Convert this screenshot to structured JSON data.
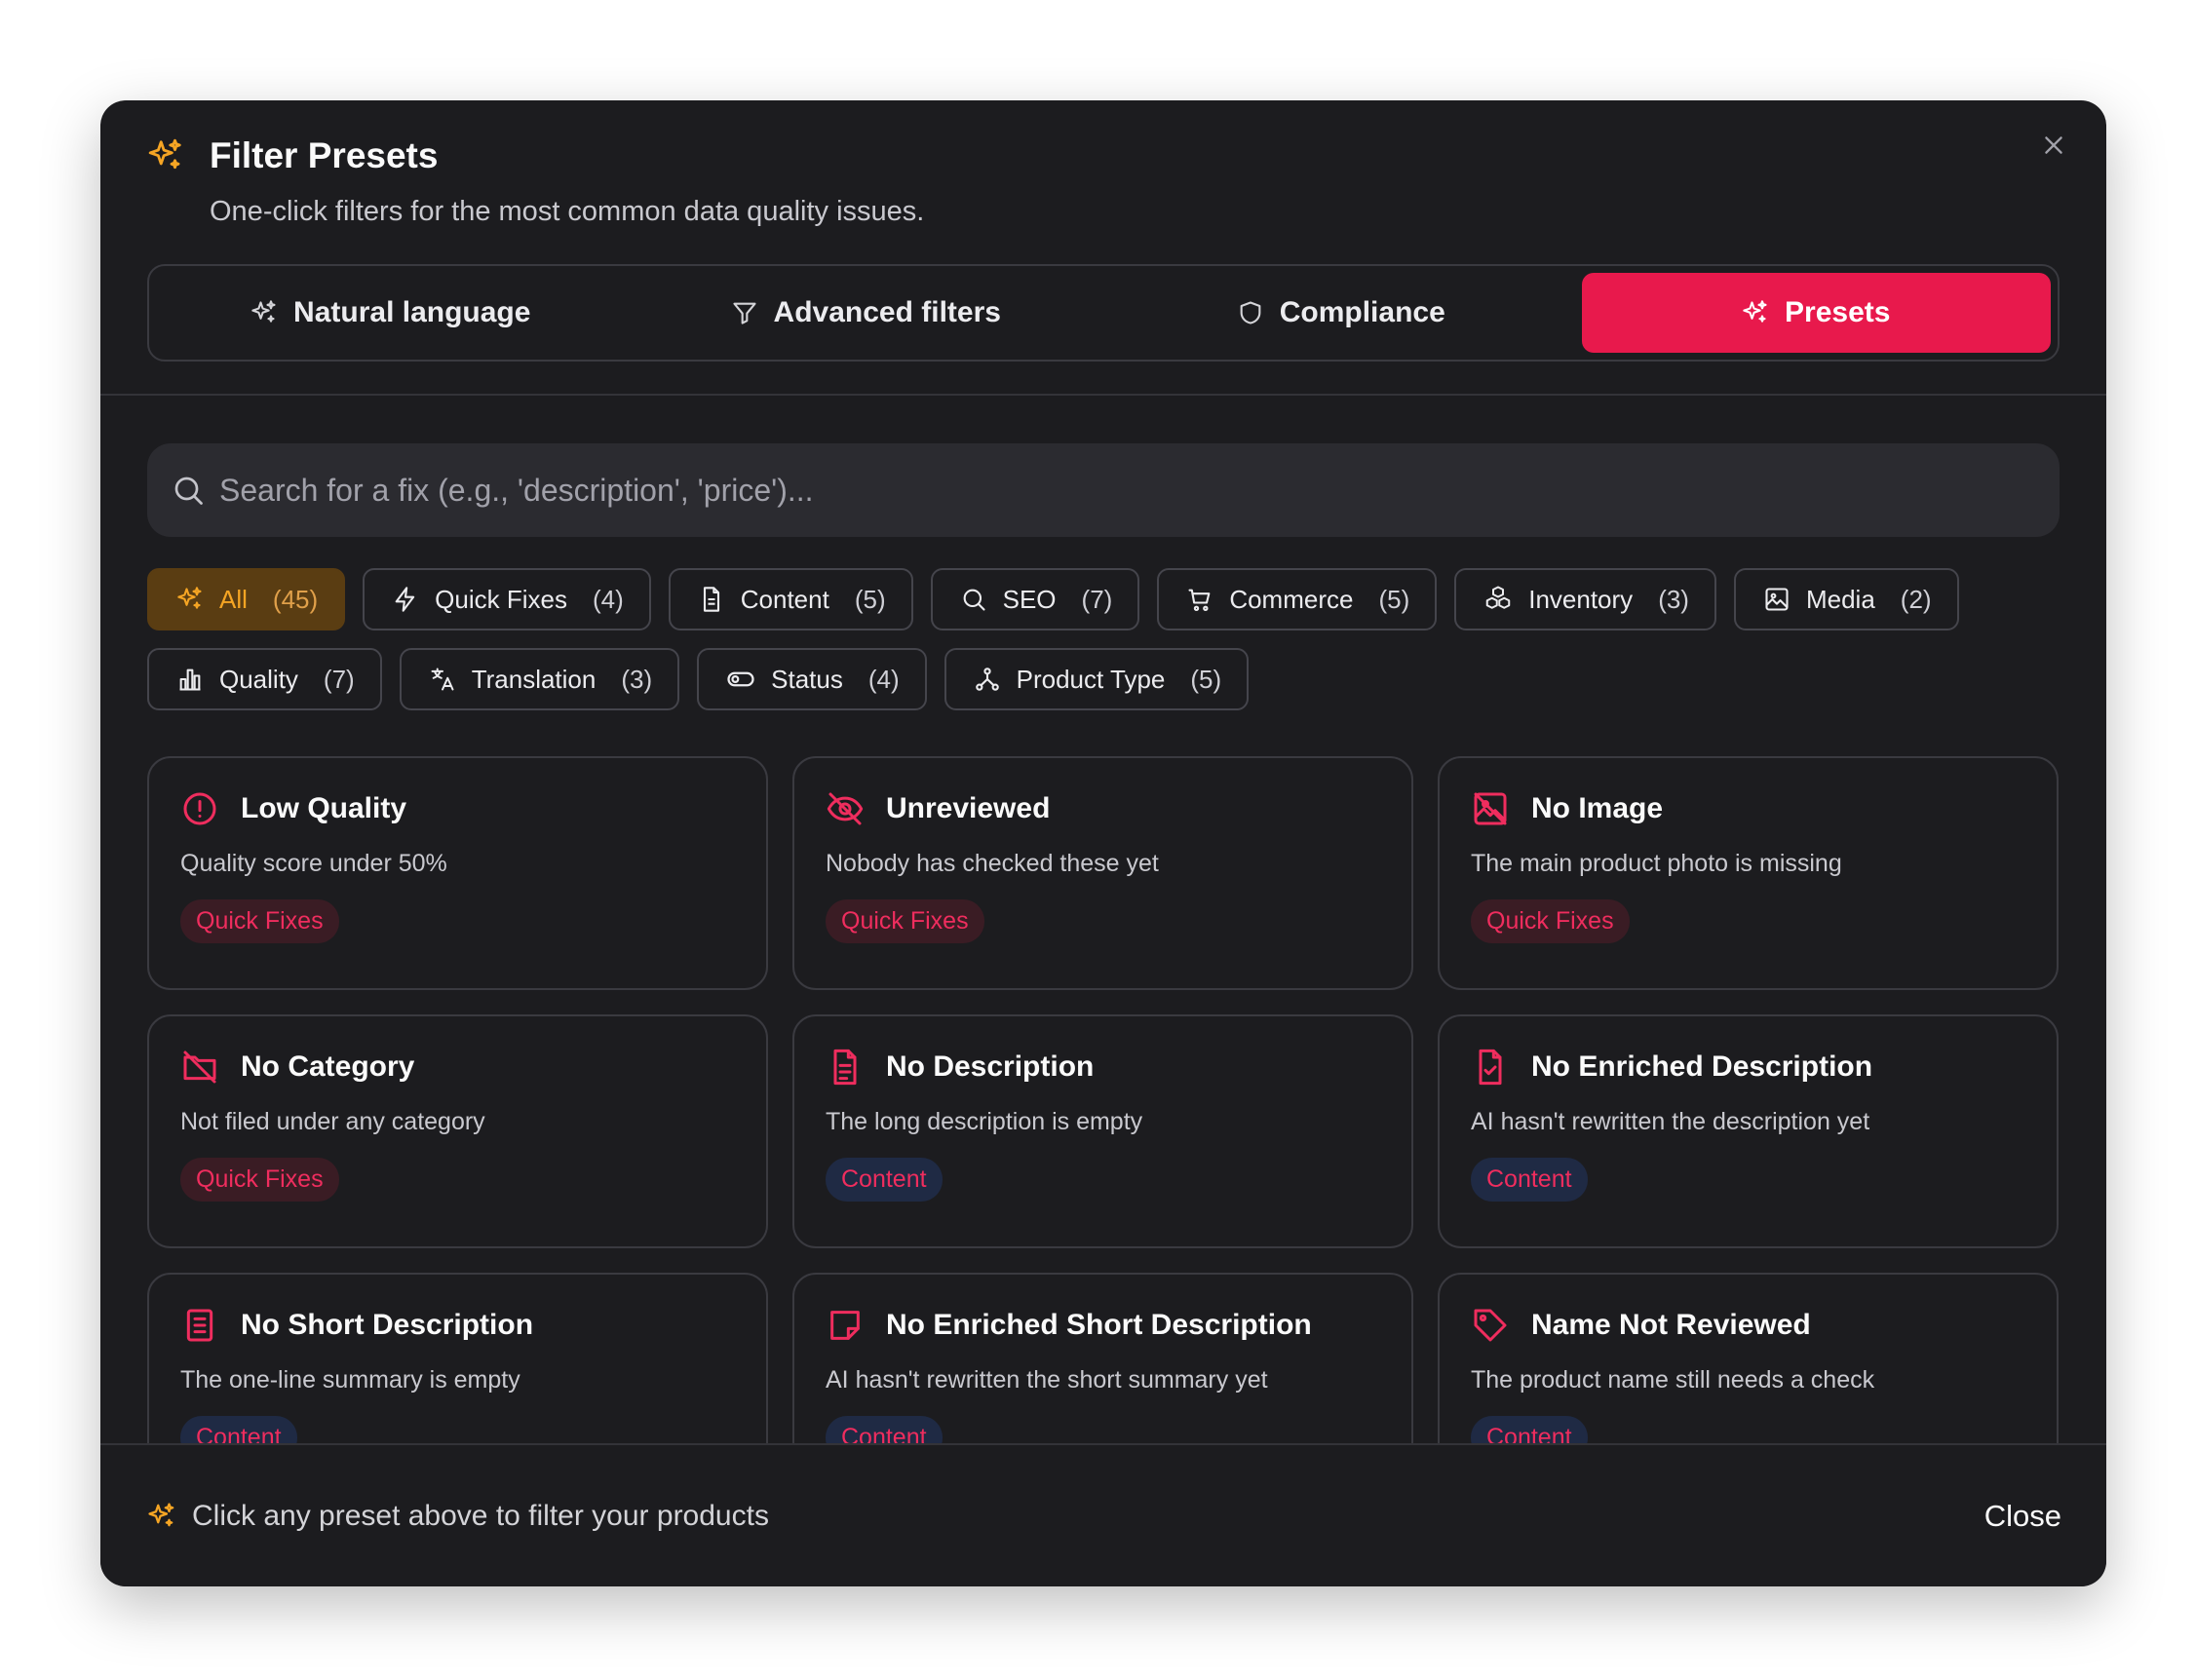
{
  "header": {
    "title": "Filter Presets",
    "subtitle": "One-click filters for the most common data quality issues."
  },
  "tabs": [
    {
      "label": "Natural language",
      "icon": "sparkles-icon"
    },
    {
      "label": "Advanced filters",
      "icon": "funnel-icon"
    },
    {
      "label": "Compliance",
      "icon": "shield-icon"
    },
    {
      "label": "Presets",
      "icon": "sparkles-icon",
      "active": true
    }
  ],
  "search": {
    "placeholder": "Search for a fix (e.g., 'description', 'price')..."
  },
  "categories": [
    {
      "label": "All",
      "count": "(45)",
      "icon": "sparkles-icon",
      "active": true
    },
    {
      "label": "Quick Fixes",
      "count": "(4)",
      "icon": "lightning-icon"
    },
    {
      "label": "Content",
      "count": "(5)",
      "icon": "document-icon"
    },
    {
      "label": "SEO",
      "count": "(7)",
      "icon": "search-icon"
    },
    {
      "label": "Commerce",
      "count": "(5)",
      "icon": "cart-icon"
    },
    {
      "label": "Inventory",
      "count": "(3)",
      "icon": "boxes-icon"
    },
    {
      "label": "Media",
      "count": "(2)",
      "icon": "image-icon"
    },
    {
      "label": "Quality",
      "count": "(7)",
      "icon": "bar-chart-icon"
    },
    {
      "label": "Translation",
      "count": "(3)",
      "icon": "translate-icon"
    },
    {
      "label": "Status",
      "count": "(4)",
      "icon": "toggle-icon"
    },
    {
      "label": "Product Type",
      "count": "(5)",
      "icon": "network-icon"
    }
  ],
  "presets": [
    {
      "title": "Low Quality",
      "description": "Quality score under 50%",
      "tag": "Quick Fixes",
      "icon": "alert-circle-icon"
    },
    {
      "title": "Unreviewed",
      "description": "Nobody has checked these yet",
      "tag": "Quick Fixes",
      "icon": "eye-off-icon"
    },
    {
      "title": "No Image",
      "description": "The main product photo is missing",
      "tag": "Quick Fixes",
      "icon": "image-off-icon"
    },
    {
      "title": "No Category",
      "description": "Not filed under any category",
      "tag": "Quick Fixes",
      "icon": "folder-off-icon"
    },
    {
      "title": "No Description",
      "description": "The long description is empty",
      "tag": "Content",
      "icon": "document-text-icon"
    },
    {
      "title": "No Enriched Description",
      "description": "AI hasn't rewritten the description yet",
      "tag": "Content",
      "icon": "document-check-icon"
    },
    {
      "title": "No Short Description",
      "description": "The one-line summary is empty",
      "tag": "Content",
      "icon": "clipboard-icon"
    },
    {
      "title": "No Enriched Short Description",
      "description": "AI hasn't rewritten the short summary yet",
      "tag": "Content",
      "icon": "sticky-note-icon"
    },
    {
      "title": "Name Not Reviewed",
      "description": "The product name still needs a check",
      "tag": "Content",
      "icon": "tag-icon"
    }
  ],
  "footer": {
    "hint": "Click any preset above to filter your products",
    "close_label": "Close"
  },
  "colors": {
    "accent": "#e8194c",
    "highlight": "#f5a524",
    "background": "#1c1c1f",
    "blue_badge": "#1f2a44",
    "red_badge": "#3a1c24"
  }
}
